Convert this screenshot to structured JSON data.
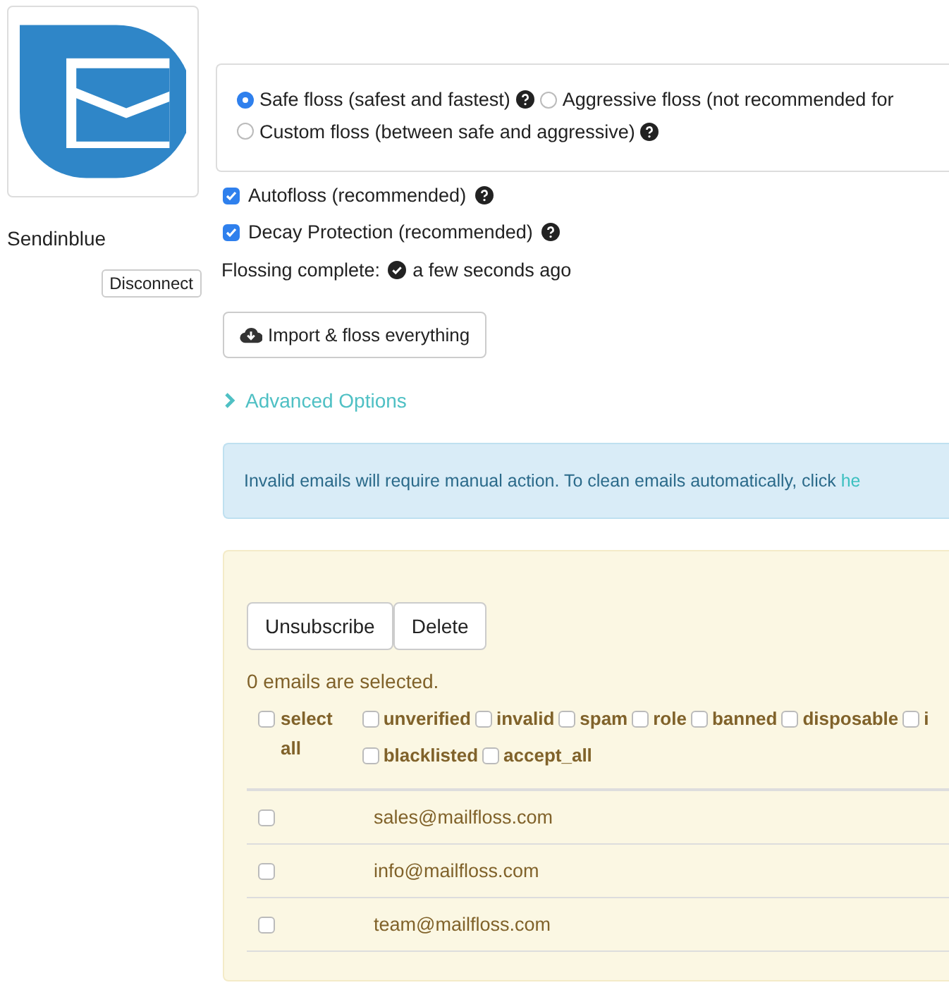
{
  "integration": {
    "name": "Sendinblue",
    "disconnect_label": "Disconnect"
  },
  "floss_modes": [
    {
      "label": "Safe floss (safest and fastest)",
      "selected": true,
      "help": true
    },
    {
      "label": "Aggressive floss (not recommended for",
      "selected": false,
      "help": false
    },
    {
      "label": "Custom floss (between safe and aggressive)",
      "selected": false,
      "help": true
    }
  ],
  "options": [
    {
      "label": "Autofloss (recommended)",
      "checked": true
    },
    {
      "label": "Decay Protection (recommended)",
      "checked": true
    }
  ],
  "status": {
    "label": "Flossing complete:",
    "time": "a few seconds ago"
  },
  "import_button": "Import & floss everything",
  "advanced": {
    "label": "Advanced Options",
    "expanded": false
  },
  "alert": {
    "text": "Invalid emails will require manual action. To clean emails automatically, click",
    "link": "he"
  },
  "actions": [
    "Unsubscribe",
    "Delete"
  ],
  "selected_count": "0 emails are selected.",
  "select_all": {
    "label": "select all",
    "checked": false
  },
  "filters": [
    {
      "label": "unverified",
      "checked": false
    },
    {
      "label": "invalid",
      "checked": false
    },
    {
      "label": "spam",
      "checked": false
    },
    {
      "label": "role",
      "checked": false
    },
    {
      "label": "banned",
      "checked": false
    },
    {
      "label": "disposable",
      "checked": false
    },
    {
      "label": "i",
      "checked": false
    },
    {
      "label": "blacklisted",
      "checked": false
    },
    {
      "label": "accept_all",
      "checked": false
    }
  ],
  "emails": [
    {
      "address": "sales@mailfloss.com",
      "checked": false
    },
    {
      "address": "info@mailfloss.com",
      "checked": false
    },
    {
      "address": "team@mailfloss.com",
      "checked": false
    }
  ]
}
